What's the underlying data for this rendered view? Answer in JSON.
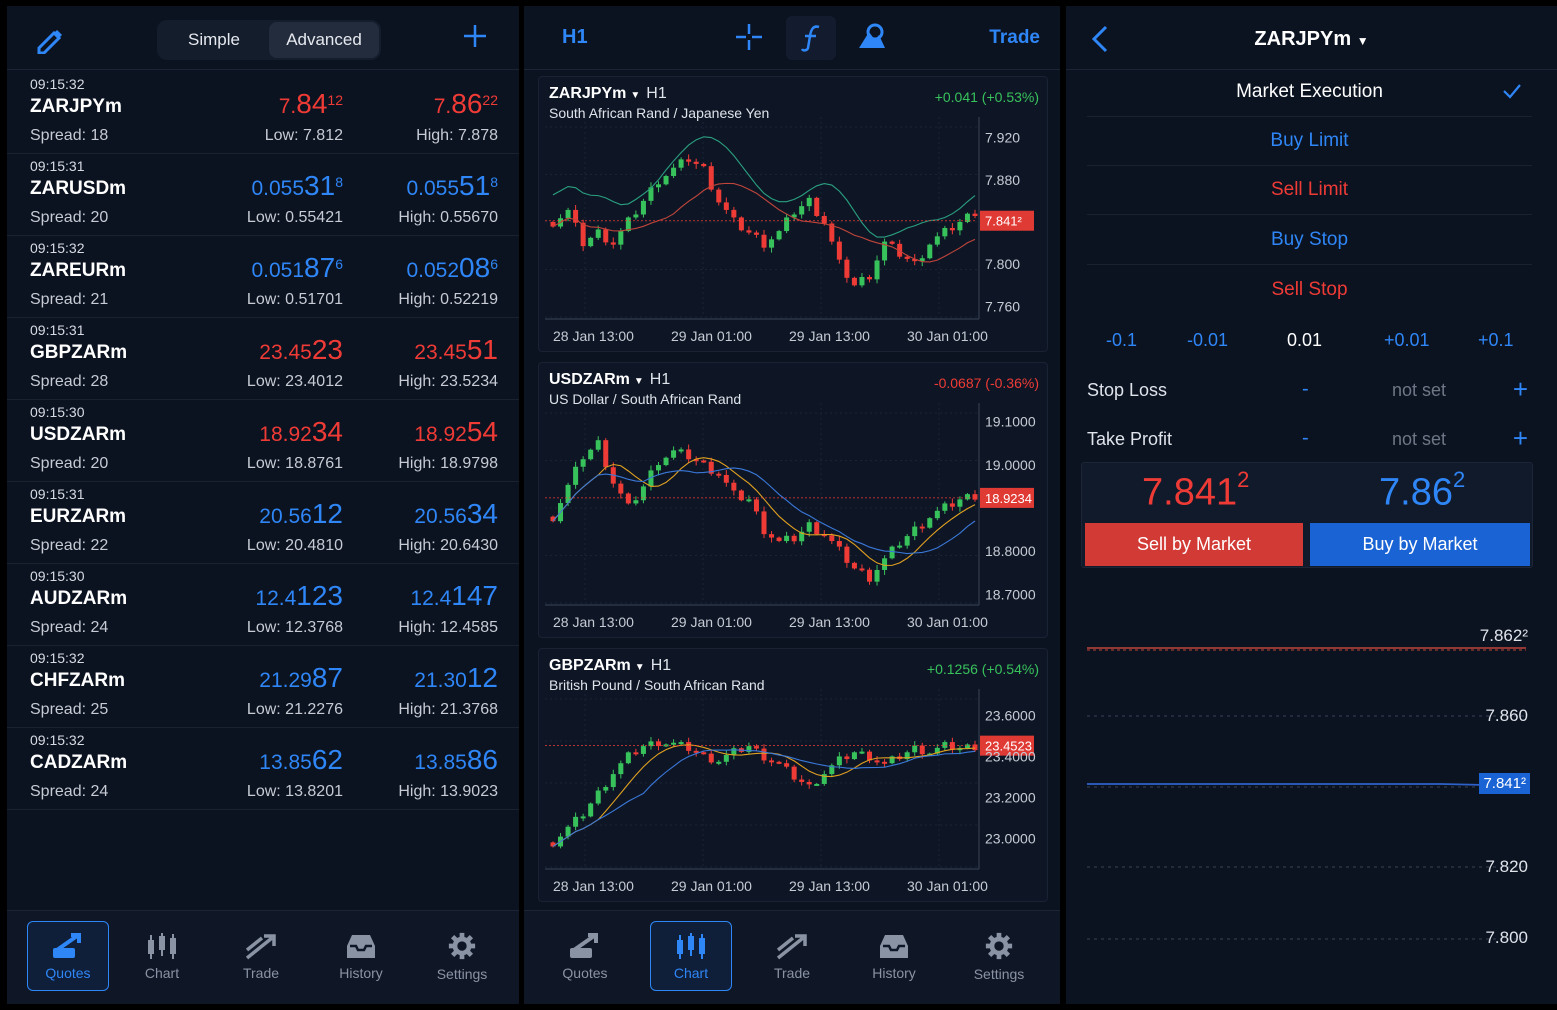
{
  "quotes_panel": {
    "tabs": [
      "Simple",
      "Advanced"
    ],
    "active_tab": "Advanced",
    "rows": [
      {
        "time": "09:15:32",
        "symbol": "ZARJPYm",
        "spread": "Spread: 18",
        "bid_pre": "7.",
        "bid_big": "84",
        "bid_sup": "1",
        "bid_suffix": "2",
        "ask_pre": "7.",
        "ask_big": "86",
        "ask_sup": "2",
        "ask_suffix": "2",
        "color": "red",
        "low": "Low: 7.812",
        "high": "High: 7.878"
      },
      {
        "time": "09:15:31",
        "symbol": "ZARUSDm",
        "spread": "Spread: 20",
        "bid_pre": "0.055",
        "bid_big": "31",
        "bid_sup": "8",
        "ask_pre": "0.055",
        "ask_big": "51",
        "ask_sup": "8",
        "color": "blue",
        "low": "Low: 0.55421",
        "high": "High: 0.55670"
      },
      {
        "time": "09:15:32",
        "symbol": "ZAREURm",
        "spread": "Spread: 21",
        "bid_pre": "0.051",
        "bid_big": "87",
        "bid_sup": "6",
        "ask_pre": "0.052",
        "ask_big": "08",
        "ask_sup": "6",
        "color": "blue",
        "low": "Low: 0.51701",
        "high": "High: 0.52219"
      },
      {
        "time": "09:15:31",
        "symbol": "GBPZARm",
        "spread": "Spread: 28",
        "bid_pre": "23.45",
        "bid_big": "23",
        "bid_sup": "",
        "ask_pre": "23.45",
        "ask_big": "51",
        "ask_sup": "",
        "color": "red",
        "low": "Low: 23.4012",
        "high": "High: 23.5234"
      },
      {
        "time": "09:15:30",
        "symbol": "USDZARm",
        "spread": "Spread: 20",
        "bid_pre": "18.92",
        "bid_big": "34",
        "bid_sup": "",
        "ask_pre": "18.92",
        "ask_big": "54",
        "ask_sup": "",
        "color": "red",
        "low": "Low: 18.8761",
        "high": "High: 18.9798"
      },
      {
        "time": "09:15:31",
        "symbol": "EURZARm",
        "spread": "Spread: 22",
        "bid_pre": "20.56",
        "bid_big": "12",
        "bid_sup": "",
        "ask_pre": "20.56",
        "ask_big": "34",
        "ask_sup": "",
        "color": "blue",
        "low": "Low: 20.4810",
        "high": "High: 20.6430"
      },
      {
        "time": "09:15:30",
        "symbol": "AUDZARm",
        "spread": "Spread: 24",
        "bid_pre": "12.4",
        "bid_big": "123",
        "bid_sup": "",
        "ask_pre": "12.4",
        "ask_big": "147",
        "ask_sup": "",
        "color": "blue",
        "low": "Low: 12.3768",
        "high": "High: 12.4585"
      },
      {
        "time": "09:15:32",
        "symbol": "CHFZARm",
        "spread": "Spread: 25",
        "bid_pre": "21.29",
        "bid_big": "87",
        "bid_sup": "",
        "ask_pre": "21.30",
        "ask_big": "12",
        "ask_sup": "",
        "color": "blue",
        "low": "Low: 21.2276",
        "high": "High: 21.3768"
      },
      {
        "time": "09:15:32",
        "symbol": "CADZARm",
        "spread": "Spread: 24",
        "bid_pre": "13.85",
        "bid_big": "62",
        "bid_sup": "",
        "ask_pre": "13.85",
        "ask_big": "86",
        "ask_sup": "",
        "color": "blue",
        "low": "Low: 13.8201",
        "high": "High: 13.9023"
      }
    ]
  },
  "nav": {
    "items": [
      {
        "label": "Quotes",
        "icon": "quotes-icon"
      },
      {
        "label": "Chart",
        "icon": "chart-icon"
      },
      {
        "label": "Trade",
        "icon": "trade-icon"
      },
      {
        "label": "History",
        "icon": "history-icon"
      },
      {
        "label": "Settings",
        "icon": "gear-icon"
      }
    ],
    "active_left": "Quotes",
    "active_middle": "Chart"
  },
  "charts_panel": {
    "timeframe": "H1",
    "toolbar_icons": [
      "crosshair-icon",
      "indicator-icon",
      "objects-icon"
    ],
    "trade_link": "Trade"
  },
  "chart_data": [
    {
      "type": "candlestick",
      "symbol": "ZARJPYm",
      "timeframe": "H1",
      "description": "South African Rand / Japanese Yen",
      "change": "+0.041 (+0.53%)",
      "direction": "up",
      "yticks": [
        "7.920",
        "7.880",
        "7.841²",
        "7.800",
        "7.760"
      ],
      "y_tick_values": [
        7.92,
        7.88,
        7.8412,
        7.8,
        7.76
      ],
      "xticks": [
        "28 Jan 13:00",
        "29 Jan 01:00",
        "29 Jan 13:00",
        "30 Jan 01:00"
      ],
      "ylim": [
        7.75,
        7.93
      ],
      "current": "7.841²",
      "current_value": 7.8412,
      "close_path": [
        7.84,
        7.85,
        7.82,
        7.83,
        7.82,
        7.84,
        7.86,
        7.88,
        7.89,
        7.9,
        7.89,
        7.86,
        7.84,
        7.83,
        7.82,
        7.83,
        7.85,
        7.86,
        7.84,
        7.8,
        7.78,
        7.79,
        7.82,
        7.81,
        7.8,
        7.82,
        7.83,
        7.84,
        7.85
      ],
      "overlay_lines": [
        "#2aa080",
        "#c0453a"
      ]
    },
    {
      "type": "candlestick",
      "symbol": "USDZARm",
      "timeframe": "H1",
      "description": "US Dollar / South African Rand",
      "change": "-0.0687 (-0.36%)",
      "direction": "down",
      "yticks": [
        "19.1000",
        "19.0000",
        "18.9234",
        "18.8000",
        "18.7000"
      ],
      "y_tick_values": [
        19.1,
        19.0,
        18.9234,
        18.8,
        18.7
      ],
      "xticks": [
        "28 Jan 13:00",
        "29 Jan 01:00",
        "29 Jan 13:00",
        "30 Jan 01:00"
      ],
      "ylim": [
        18.68,
        19.12
      ],
      "current": "18.9234",
      "current_value": 18.9234,
      "close_path": [
        18.88,
        18.95,
        19.02,
        19.05,
        18.96,
        18.9,
        18.95,
        19.01,
        19.03,
        19.02,
        19.0,
        18.98,
        18.93,
        18.92,
        18.85,
        18.82,
        18.83,
        18.86,
        18.84,
        18.8,
        18.76,
        18.74,
        18.78,
        18.82,
        18.85,
        18.88,
        18.9,
        18.92,
        18.93
      ],
      "overlay_lines": [
        "#e0a020",
        "#3a78d8"
      ]
    },
    {
      "type": "candlestick",
      "symbol": "GBPZARm",
      "timeframe": "H1",
      "description": "British Pound / South African Rand",
      "change": "+0.1256 (+0.54%)",
      "direction": "up",
      "yticks": [
        "23.6000",
        "23.4000",
        "23.4523",
        "23.2000",
        "23.0000"
      ],
      "y_tick_values": [
        23.6,
        23.4,
        23.4523,
        23.2,
        23.0
      ],
      "xticks": [
        "28 Jan 13:00",
        "29 Jan 01:00",
        "29 Jan 13:00",
        "30 Jan 01:00"
      ],
      "ylim": [
        22.86,
        23.68
      ],
      "current": "23.4523",
      "current_value": 23.4523,
      "close_path": [
        22.98,
        23.05,
        23.12,
        23.22,
        23.32,
        23.4,
        23.45,
        23.47,
        23.46,
        23.44,
        23.4,
        23.38,
        23.42,
        23.45,
        23.4,
        23.36,
        23.3,
        23.25,
        23.32,
        23.38,
        23.42,
        23.4,
        23.36,
        23.4,
        23.44,
        23.42,
        23.45,
        23.44,
        23.45
      ],
      "overlay_lines": [
        "#e0a020",
        "#3a78d8"
      ]
    }
  ],
  "order_panel": {
    "symbol": "ZARJPYm",
    "order_types": [
      {
        "label": "Market Execution",
        "color": "white",
        "checked": true
      },
      {
        "label": "Buy Limit",
        "color": "blue"
      },
      {
        "label": "Sell Limit",
        "color": "red"
      },
      {
        "label": "Buy Stop",
        "color": "blue"
      },
      {
        "label": "Sell Stop",
        "color": "red"
      }
    ],
    "volume_steps": [
      "-0.1",
      "-0.01",
      "0.01",
      "+0.01",
      "+0.1"
    ],
    "stop_loss": {
      "label": "Stop Loss",
      "minus": "-",
      "value": "not set",
      "plus": "+"
    },
    "take_profit": {
      "label": "Take Profit",
      "minus": "-",
      "value": "not set",
      "plus": "+"
    },
    "sell_price": {
      "pre": "7.",
      "big": "84",
      "sup": "1",
      "suffix": "2"
    },
    "buy_price": {
      "pre": "7.",
      "big": "86",
      "sup": "2"
    },
    "sell_button": "Sell by Market",
    "buy_button": "Buy by Market",
    "depth_ticks": [
      "7.862²",
      "7.860",
      "7.841²",
      "7.820",
      "7.800"
    ]
  },
  "colors": {
    "red": "#ef3b36",
    "blue": "#2f86f6",
    "bg": "#0b1220",
    "green": "#38c25b"
  }
}
